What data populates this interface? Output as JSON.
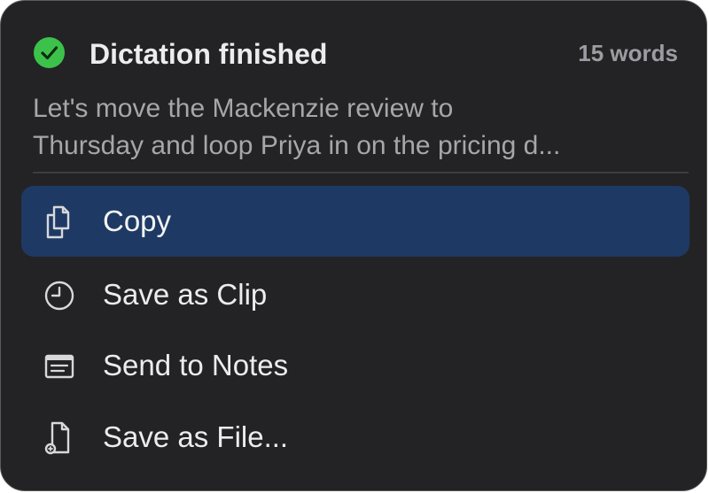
{
  "header": {
    "title": "Dictation finished",
    "word_count": "15 words",
    "status_icon": "checkmark-circle-icon",
    "status_color": "#3cc24a"
  },
  "preview": {
    "line1": "Let's move the Mackenzie review to",
    "line2": "Thursday and loop Priya in on the pricing d..."
  },
  "menu": {
    "selected_color": "#1e3a64",
    "items": [
      {
        "label": "Copy",
        "icon": "copy-icon",
        "selected": true
      },
      {
        "label": "Save as Clip",
        "icon": "clock-icon",
        "selected": false
      },
      {
        "label": "Send to Notes",
        "icon": "notes-icon",
        "selected": false
      },
      {
        "label": "Save as File...",
        "icon": "file-icon",
        "selected": false
      }
    ]
  }
}
